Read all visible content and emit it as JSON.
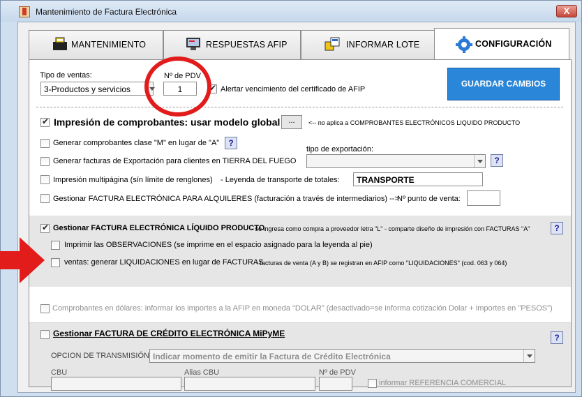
{
  "window": {
    "title": "Mantenimiento de Factura Electrónica",
    "close_label": "X"
  },
  "tabs": [
    {
      "label": "MANTENIMIENTO",
      "icon": "cash-register-icon"
    },
    {
      "label": "RESPUESTAS AFIP",
      "icon": "monitor-icon"
    },
    {
      "label": "INFORMAR LOTE",
      "icon": "batch-windows-icon"
    },
    {
      "label": "CONFIGURACIÓN",
      "icon": "gear-icon",
      "active": true
    }
  ],
  "header": {
    "tipo_ventas_label": "Tipo de ventas:",
    "tipo_ventas_value": "3-Productos y servicios",
    "pdv_label": "Nº de PDV",
    "pdv_value": "1",
    "alert_cert_label": "Alertar vencimiento del certificado de AFIP",
    "save_button": "GUARDAR CAMBIOS"
  },
  "impresion": {
    "label": "Impresión de comprobantes: usar modelo global",
    "dots_button": "...",
    "note": "<-- no aplica a COMPROBANTES ELECTRÓNICOS LIQUIDO PRODUCTO"
  },
  "options": {
    "clase_m": "Generar comprobantes clase \"M\" en lugar de \"A\"",
    "exportacion": "Generar facturas de Exportación para clientes en TIERRA DEL FUEGO",
    "tipo_exportacion_label": "tipo de exportación:",
    "multipagina": "Impresión multipágina (sín límite de renglones)",
    "leyenda_label": "- Leyenda de transporte de totales:",
    "leyenda_value": "TRANSPORTE",
    "alquileres": "Gestionar FACTURA ELECTRÓNICA PARA ALQUILERES (facturación a través de intermediarios) -->",
    "punto_venta_label": "Nº punto de venta:"
  },
  "liquido": {
    "label": "Gestionar FACTURA ELECTRÓNICA LÍQUIDO PRODUCTO",
    "note": "- se ingresa como compra a proveedor letra \"L\" - comparte diseño de impresión con FACTURAS \"A\"",
    "observaciones": "Imprimir las OBSERVACIONES (se imprime en el espacio asignado para la leyenda al pie)",
    "ventas_label": "ventas: generar LIQUIDACIONES en lugar de FACTURAS",
    "ventas_note": "- facturas de venta (A y B) se registran en AFIP como \"LIQUIDACIONES\" (cod. 063 y 064)"
  },
  "dolares": "Comprobantes en dólares: informar los importes a la AFIP en moneda \"DOLAR\" (desactivado=se informa cotización Dolar + importes en \"PESOS\")",
  "credito": {
    "label": "Gestionar FACTURA DE CRÉDITO ELECTRÓNICA MiPyME",
    "transmision_label": "OPCION DE TRANSMISIÓN:",
    "transmision_value": "Indicar momento de emitir la Factura de Crédito Electrónica",
    "cbu_label": "CBU",
    "alias_label": "Alias CBU",
    "pdv_label": "Nº de PDV",
    "referencia_label": "informar REFERENCIA COMERCIAL"
  },
  "help_label": "?",
  "annotations": {
    "circle_color": "#e21b1b",
    "arrow_color": "#e21b1b"
  },
  "colors": {
    "save_button": "#2a86d8",
    "accent": "#1f6fc4"
  }
}
